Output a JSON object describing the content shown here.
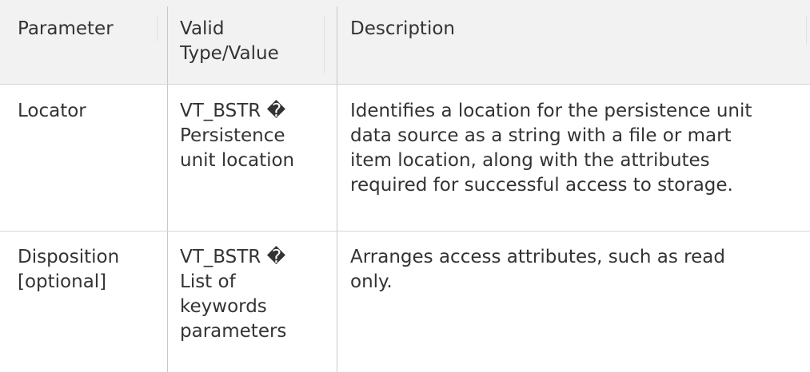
{
  "table": {
    "headers": {
      "parameter": [
        "Parameter"
      ],
      "valid_type": [
        "Valid",
        "Type/Value"
      ],
      "description": [
        "Description"
      ]
    },
    "rows": [
      {
        "parameter": [
          "Locator"
        ],
        "valid_type": [
          "VT_BSTR �",
          "Persistence",
          "unit location"
        ],
        "description": [
          "Identifies a location for the persistence unit",
          "data source as a string with a file or mart",
          "item location, along with the attributes",
          "required for successful access to storage."
        ]
      },
      {
        "parameter": [
          "Disposition",
          "[optional]"
        ],
        "valid_type": [
          "VT_BSTR �",
          "List of",
          "keywords",
          "parameters"
        ],
        "description": [
          "Arranges access attributes, such as read",
          "only."
        ]
      }
    ]
  },
  "colors": {
    "header_background": "#f2f2f2",
    "text": "#333333",
    "grid_lines": "#c8c8c8"
  }
}
